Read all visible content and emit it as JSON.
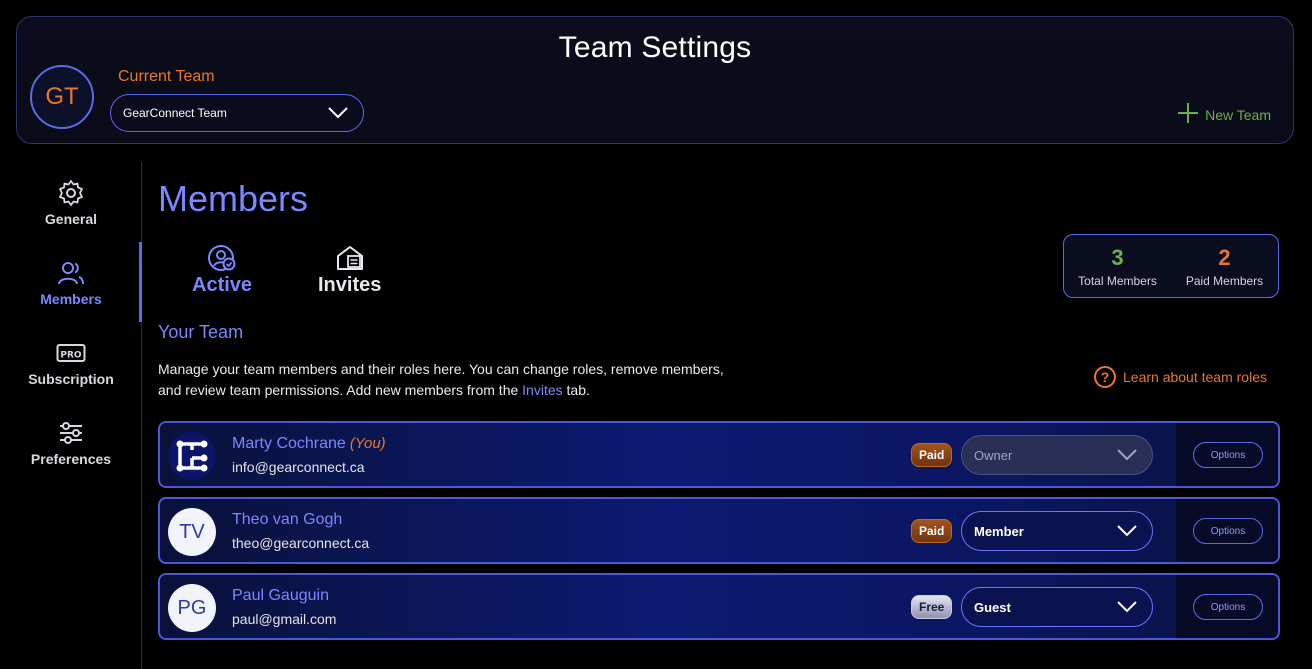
{
  "header": {
    "title": "Team Settings",
    "avatar_initials": "GT",
    "current_team_label": "Current Team",
    "team_select_value": "GearConnect Team",
    "new_team_label": "New Team"
  },
  "sidebar": {
    "items": [
      {
        "label": "General",
        "icon": "gear-icon"
      },
      {
        "label": "Members",
        "icon": "members-icon",
        "active": true
      },
      {
        "label": "Subscription",
        "icon": "pro-icon"
      },
      {
        "label": "Preferences",
        "icon": "sliders-icon"
      }
    ]
  },
  "main": {
    "title": "Members",
    "tabs": [
      {
        "label": "Active",
        "active": true
      },
      {
        "label": "Invites",
        "active": false
      }
    ],
    "stats": {
      "total_value": "3",
      "total_label": "Total Members",
      "paid_value": "2",
      "paid_label": "Paid Members"
    },
    "section_title": "Your Team",
    "description_before": "Manage your team members and their roles here. You can change roles, remove members, and review team permissions. Add new members from the ",
    "description_link": "Invites",
    "description_after": " tab.",
    "learn_label": "Learn about team roles"
  },
  "members": [
    {
      "name": "Marty Cochrane",
      "you_tag": "(You)",
      "email": "info@gearconnect.ca",
      "initials": "",
      "badge": "Paid",
      "role": "Owner",
      "options": "Options"
    },
    {
      "name": "Theo van Gogh",
      "you_tag": "",
      "email": "theo@gearconnect.ca",
      "initials": "TV",
      "badge": "Paid",
      "role": "Member",
      "options": "Options"
    },
    {
      "name": "Paul Gauguin",
      "you_tag": "",
      "email": "paul@gmail.com",
      "initials": "PG",
      "badge": "Free",
      "role": "Guest",
      "options": "Options"
    }
  ],
  "colors": {
    "accent": "#7c86ff",
    "orange": "#e8772e",
    "green": "#6fae4a"
  }
}
